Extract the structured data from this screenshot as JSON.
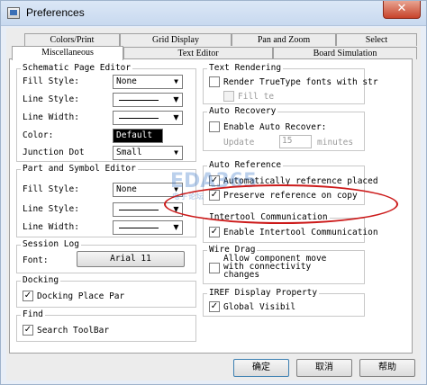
{
  "window": {
    "title": "Preferences",
    "close_glyph": "✕"
  },
  "tabs": {
    "row1": [
      "Colors/Print",
      "Grid Display",
      "Pan and Zoom",
      "Select"
    ],
    "row2": [
      "Miscellaneous",
      "Text Editor",
      "Board Simulation"
    ]
  },
  "schematic": {
    "title": "Schematic Page Editor",
    "fill_style_label": "Fill Style:",
    "fill_style_value": "None",
    "line_style_label": "Line Style:",
    "line_width_label": "Line Width:",
    "color_label": "Color:",
    "color_value": "Default",
    "junction_label": "Junction Dot",
    "junction_value": "Small"
  },
  "part": {
    "title": "Part and Symbol Editor",
    "fill_style_label": "Fill Style:",
    "fill_style_value": "None",
    "line_style_label": "Line Style:",
    "line_width_label": "Line Width:"
  },
  "session_log": {
    "title": "Session Log",
    "font_label": "Font:",
    "font_value": "Arial 11"
  },
  "docking": {
    "title": "Docking",
    "option": "Docking Place Par"
  },
  "find": {
    "title": "Find",
    "option": "Search ToolBar"
  },
  "text_rendering": {
    "title": "Text Rendering",
    "option1": "Render TrueType fonts with str",
    "option2": "Fill te"
  },
  "auto_recovery": {
    "title": "Auto Recovery",
    "option": "Enable Auto Recover:",
    "update_label": "Update",
    "update_value": "15",
    "minutes_label": "minutes"
  },
  "auto_reference": {
    "title": "Auto Reference",
    "option1": "Automatically reference placed",
    "option2": "Preserve reference on copy"
  },
  "intertool": {
    "title": "Intertool Communication",
    "option": "Enable Intertool Communication"
  },
  "wire_drag": {
    "title": "Wire Drag",
    "option_line1": "Allow component move",
    "option_line2": "with connectivity",
    "option_line3": "changes"
  },
  "iref": {
    "title": "IREF Display Property",
    "option": "Global Visibil"
  },
  "buttons": {
    "ok": "确定",
    "cancel": "取消",
    "help": "帮助"
  },
  "watermark": {
    "text": "EDA365",
    "sub": "电子论坛"
  },
  "colors": {
    "accent_red": "#cc1a1a",
    "title_bar": "#c8d9ef"
  }
}
